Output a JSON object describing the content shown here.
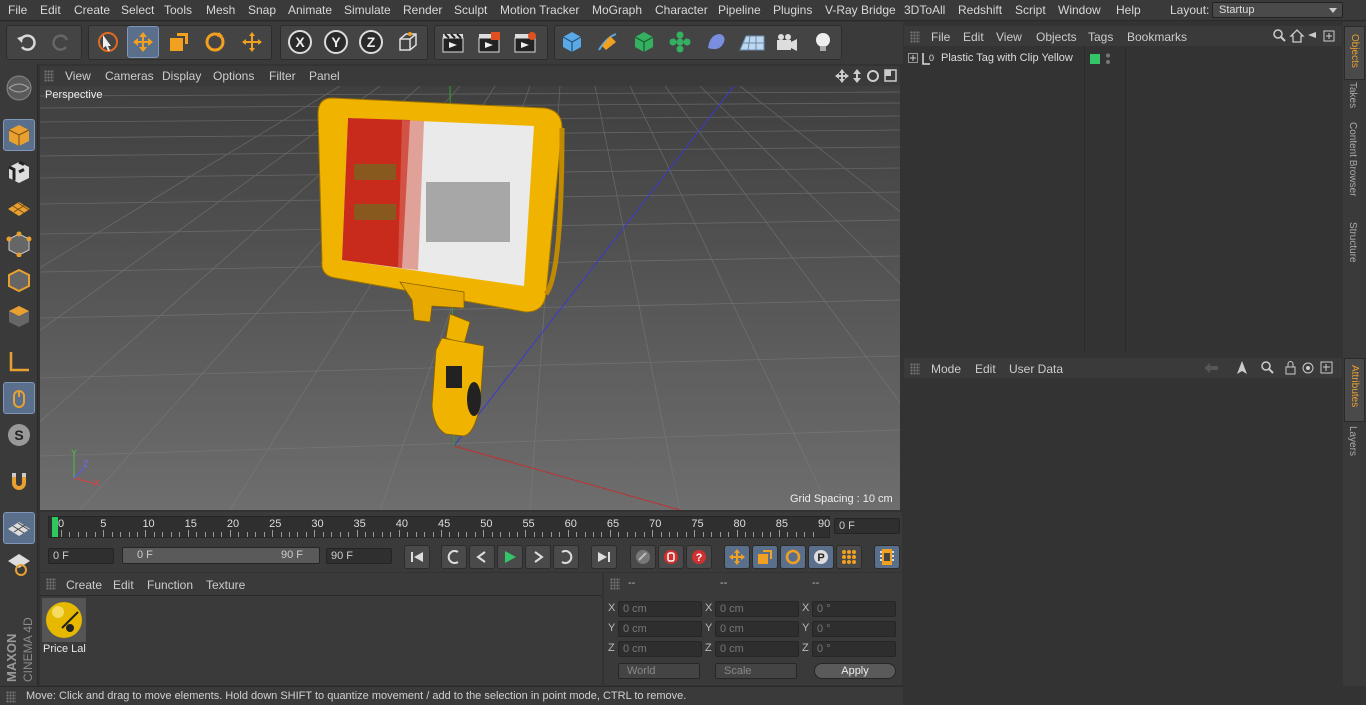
{
  "menu": {
    "items": [
      "File",
      "Edit",
      "Create",
      "Select",
      "Tools",
      "Mesh",
      "Snap",
      "Animate",
      "Simulate",
      "Render",
      "Sculpt",
      "Motion Tracker",
      "MoGraph",
      "Character",
      "Pipeline",
      "Plugins",
      "V-Ray Bridge",
      "3DToAll",
      "Redshift",
      "Script",
      "Window",
      "Help"
    ],
    "layout_label": "Layout:",
    "layout_value": "Startup"
  },
  "viewport": {
    "menu": [
      "View",
      "Cameras",
      "Display",
      "Options",
      "Filter",
      "Panel"
    ],
    "camera_label": "Perspective",
    "grid_spacing": "Grid Spacing : 10 cm"
  },
  "timeline": {
    "ticks": [
      "0",
      "5",
      "10",
      "15",
      "20",
      "25",
      "30",
      "35",
      "40",
      "45",
      "50",
      "55",
      "60",
      "65",
      "70",
      "75",
      "80",
      "85",
      "90"
    ],
    "current_frame": "0 F"
  },
  "transport": {
    "start_field": "0 F",
    "range_start": "0 F",
    "range_end": "90 F",
    "end_field": "90 F"
  },
  "materials": {
    "menu": [
      "Create",
      "Edit",
      "Function",
      "Texture"
    ],
    "items": [
      {
        "name": "Price Lal"
      }
    ]
  },
  "coords": {
    "headers": [
      "--",
      "--",
      "--"
    ],
    "rows": [
      {
        "axis": "X",
        "pos": "0 cm",
        "size_axis": "X",
        "size": "0 cm",
        "rot_axis": "X",
        "rot": "0 °"
      },
      {
        "axis": "Y",
        "pos": "0 cm",
        "size_axis": "Y",
        "size": "0 cm",
        "rot_axis": "Y",
        "rot": "0 °"
      },
      {
        "axis": "Z",
        "pos": "0 cm",
        "size_axis": "Z",
        "size": "0 cm",
        "rot_axis": "Z",
        "rot": "0 °"
      }
    ],
    "mode_select": "World",
    "scale_select": "Scale",
    "apply_label": "Apply"
  },
  "status": {
    "text": "Move: Click and drag to move elements. Hold down SHIFT to quantize movement / add to the selection in point mode, CTRL to remove."
  },
  "objects": {
    "menu": [
      "File",
      "Edit",
      "View",
      "Objects",
      "Tags",
      "Bookmarks"
    ],
    "items": [
      {
        "name": "Plastic Tag with Clip Yellow"
      }
    ]
  },
  "attributes": {
    "menu": [
      "Mode",
      "Edit",
      "User Data"
    ]
  },
  "right_tabs": [
    "Objects",
    "Takes",
    "Content Browser",
    "Structure"
  ],
  "right_tabs2": [
    "Attributes",
    "Layers"
  ],
  "brand": {
    "maxon": "MAXON",
    "product": "CINEMA 4D"
  },
  "colors": {
    "selected_tool": "#5a6f8c",
    "tag_yellow": "#f0b400",
    "accent_green": "#34c46a"
  }
}
